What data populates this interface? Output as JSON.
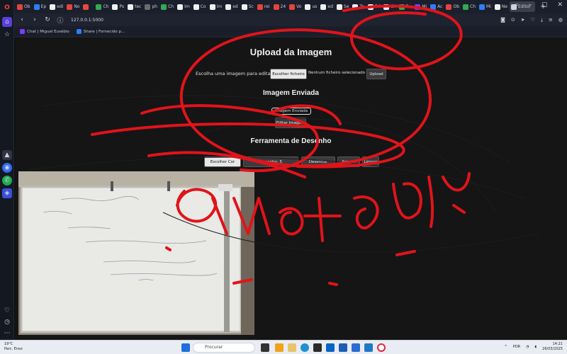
{
  "browser": {
    "tabs": [
      {
        "label": "Ob",
        "color": "#e2463b"
      },
      {
        "label": "Ep",
        "color": "#2d7ff9"
      },
      {
        "label": "edi",
        "color": "#f0f0f0"
      },
      {
        "label": "No",
        "color": "#e2463b"
      },
      {
        "label": "",
        "color": "#e24b3b"
      },
      {
        "label": "Ch",
        "color": "#34a853"
      },
      {
        "label": "Ps",
        "color": "#f0f0f0"
      },
      {
        "label": "tec",
        "color": "#f0f0f0"
      },
      {
        "label": "ph",
        "color": "#6b6b6b"
      },
      {
        "label": "Ch",
        "color": "#34a853"
      },
      {
        "label": "Im",
        "color": "#f0f0f0"
      },
      {
        "label": "Co",
        "color": "#f0f0f0"
      },
      {
        "label": "Im",
        "color": "#f0f0f0"
      },
      {
        "label": "ed",
        "color": "#f0f0f0"
      },
      {
        "label": "Sc",
        "color": "#f0f0f0"
      },
      {
        "label": "rei",
        "color": "#e2463b"
      },
      {
        "label": "24",
        "color": "#e2463b"
      },
      {
        "label": "Vo",
        "color": "#e2463b"
      },
      {
        "label": "us",
        "color": "#f0f0f0"
      },
      {
        "label": "ed",
        "color": "#f0f0f0"
      },
      {
        "label": "Se",
        "color": "#f0f0f0"
      },
      {
        "label": "Te",
        "color": "#f0f0f0"
      },
      {
        "label": "Ed",
        "color": "#f0f0f0"
      },
      {
        "label": "th",
        "color": "#f0f0f0"
      },
      {
        "label": "Ba",
        "color": "#34a853"
      },
      {
        "label": "Mi",
        "color": "#7a3cff"
      },
      {
        "label": "Ac",
        "color": "#2d7ff9"
      },
      {
        "label": "Ob",
        "color": "#e2463b"
      },
      {
        "label": "Ch",
        "color": "#34a853"
      },
      {
        "label": "Mi",
        "color": "#2d7ff9"
      },
      {
        "label": "Ne",
        "color": "#f0f0f0"
      },
      {
        "label": "Editor",
        "color": "#cfd3dc",
        "active": true
      }
    ],
    "url": "127.0.0.1:5000",
    "bookmarks": [
      {
        "label": "Chat | Miguel Eusébio",
        "color": "#7a3cff"
      },
      {
        "label": "Share | Fornecido p...",
        "color": "#2d7ff9"
      }
    ],
    "new_tab_symbol": "+"
  },
  "page": {
    "upload_title": "Upload da Imagem",
    "choose_label": "Escolha uma imagem para editar:",
    "choose_file_button": "Escolher ficheiro",
    "no_file_text": "Nenhum ficheiro selecionado",
    "upload_button": "Upload",
    "sent_title": "Imagem Enviada",
    "sent_image_alt": "Imagem Enviada",
    "edit_button": "Editar Imagem",
    "tools_title": "Ferramenta de Desenho",
    "tool_buttons": [
      "Escolher Cor",
      "Tamanho: 5",
      "Desenhar",
      "Apagar",
      "Limpar"
    ]
  },
  "taskbar": {
    "weather_temp": "19°C",
    "weather_desc": "Parc. Enso",
    "search_placeholder": "Procurar",
    "lang": "POR",
    "time": "14:21",
    "date": "26/03/2025"
  },
  "colors": {
    "ink": "#e0141a",
    "tab_bg": "#1b1f2b",
    "page_bg": "#151516"
  }
}
